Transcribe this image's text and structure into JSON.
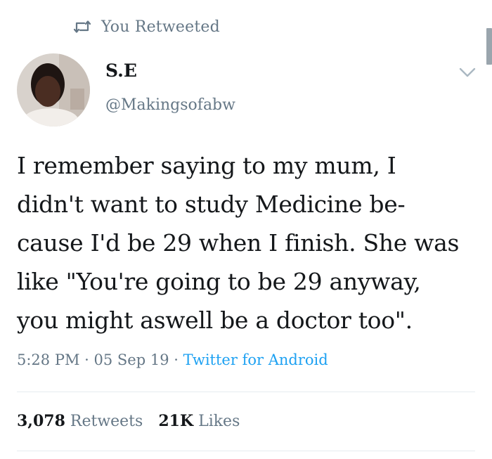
{
  "retweet_banner": {
    "icon": "retweet-icon",
    "label": "You Retweeted"
  },
  "author": {
    "display_name": "S.E",
    "handle": "@Makingsofabw",
    "avatar": "profile-photo"
  },
  "tweet": {
    "text": "I remember saying to my mum, I\ndidn't want to study Medicine be-\ncause I'd be 29 when I finish. She was\nlike \"You're going to be 29 anyway,\nyou might aswell be a doctor too\"."
  },
  "meta": {
    "time": "5:28 PM",
    "separator": " · ",
    "date": "05 Sep 19",
    "source": "Twitter for Android"
  },
  "stats": {
    "retweets_count": "3,078",
    "retweets_label": "Retweets",
    "likes_count": "21K",
    "likes_label": "Likes"
  },
  "colors": {
    "text": "#14171a",
    "secondary": "#657786",
    "link": "#1da1f2",
    "divider": "#e6ecf0"
  }
}
